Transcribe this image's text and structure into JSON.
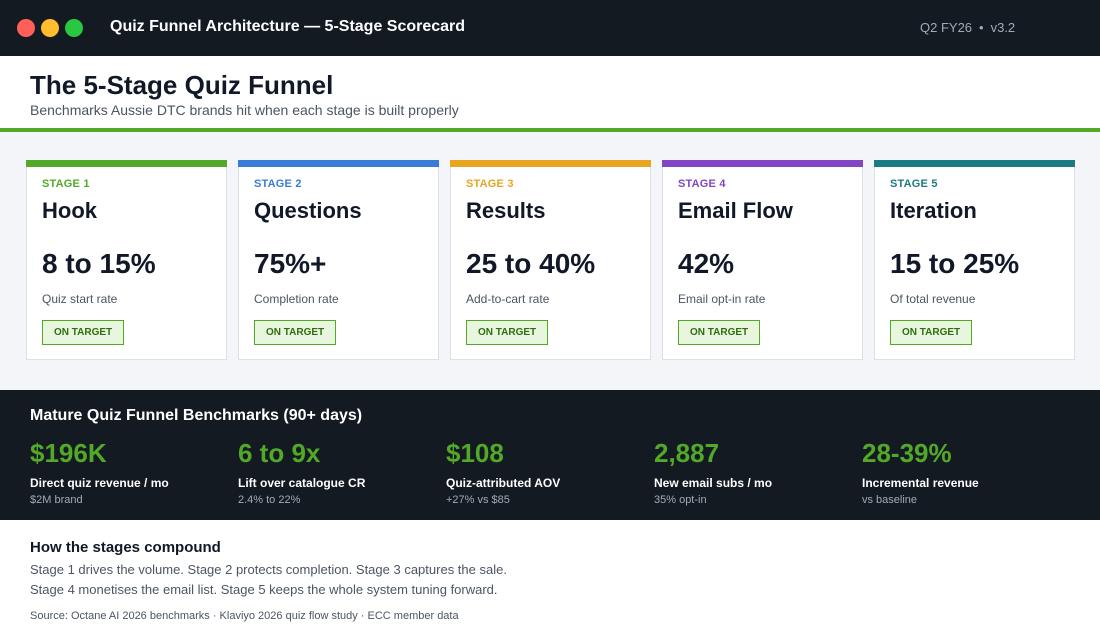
{
  "window": {
    "title": "Quiz Funnel Architecture — 5-Stage Scorecard",
    "period": "Q2 FY26",
    "version": "v3.2"
  },
  "header": {
    "title": "The 5-Stage Quiz Funnel",
    "subtitle": "Benchmarks Aussie DTC brands hit when each stage is built properly"
  },
  "colors": {
    "accent_green": "#52a928",
    "dark_bg": "#131a22",
    "stage_1": "#52a928",
    "stage_2": "#3a7bd5",
    "stage_3": "#e8a520",
    "stage_4": "#8245c4",
    "stage_5": "#1c7a82"
  },
  "stages": [
    {
      "label": "STAGE 1",
      "name": "Hook",
      "value": "8 to 15%",
      "metric": "Quiz start rate",
      "status": "ON TARGET",
      "color": "#52a928"
    },
    {
      "label": "STAGE 2",
      "name": "Questions",
      "value": "75%+",
      "metric": "Completion rate",
      "status": "ON TARGET",
      "color": "#3a7bd5"
    },
    {
      "label": "STAGE 3",
      "name": "Results",
      "value": "25 to 40%",
      "metric": "Add-to-cart rate",
      "status": "ON TARGET",
      "color": "#e8a520"
    },
    {
      "label": "STAGE 4",
      "name": "Email Flow",
      "value": "42%",
      "metric": "Email opt-in rate",
      "status": "ON TARGET",
      "color": "#8245c4"
    },
    {
      "label": "STAGE 5",
      "name": "Iteration",
      "value": "15 to 25%",
      "metric": "Of total revenue",
      "status": "ON TARGET",
      "color": "#1c7a82"
    }
  ],
  "benchmarks": {
    "title": "Mature Quiz Funnel Benchmarks (90+ days)",
    "items": [
      {
        "value": "$196K",
        "label": "Direct quiz revenue / mo",
        "sub": "$2M brand"
      },
      {
        "value": "6 to 9x",
        "label": "Lift over catalogue CR",
        "sub": "2.4% to 22%"
      },
      {
        "value": "$108",
        "label": "Quiz-attributed AOV",
        "sub": "+27% vs $85"
      },
      {
        "value": "2,887",
        "label": "New email subs / mo",
        "sub": "35% opt-in"
      },
      {
        "value": "28-39%",
        "label": "Incremental revenue",
        "sub": "vs baseline"
      }
    ]
  },
  "compound": {
    "title": "How the stages compound",
    "line1": "Stage 1 drives the volume. Stage 2 protects completion. Stage 3 captures the sale.",
    "line2": "Stage 4 monetises the email list. Stage 5 keeps the whole system tuning forward."
  },
  "source": "Source: Octane AI 2026 benchmarks · Klaviyo 2026 quiz flow study · ECC member data"
}
